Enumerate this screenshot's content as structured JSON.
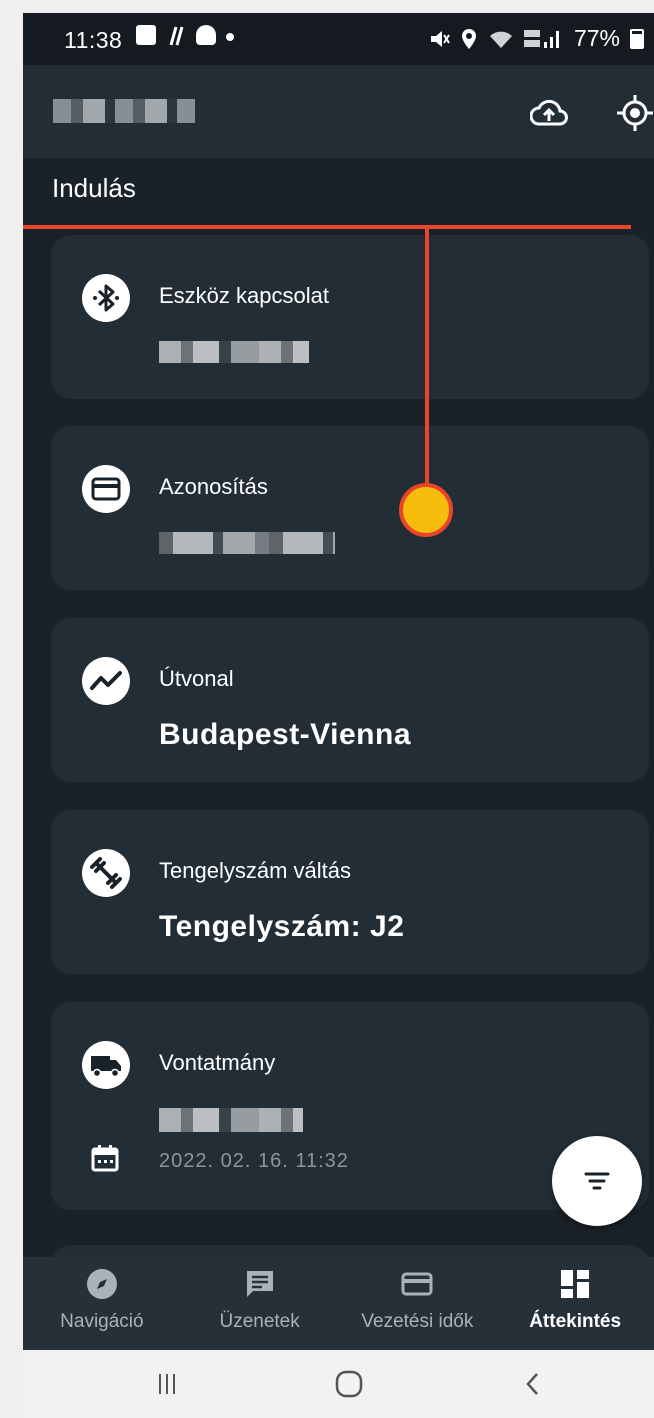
{
  "status_bar": {
    "time": "11:38",
    "battery": "77%"
  },
  "app_bar": {
    "icons": [
      "cloud-upload-icon",
      "gps-target-icon"
    ]
  },
  "section": {
    "title": "Indulás"
  },
  "cards": [
    {
      "icon": "bluetooth-icon",
      "title": "Eszköz kapcsolat"
    },
    {
      "icon": "card-icon",
      "title": "Azonosítás"
    },
    {
      "icon": "route-icon",
      "title": "Útvonal",
      "value": "Budapest-Vienna"
    },
    {
      "icon": "axle-icon",
      "title": "Tengelyszám váltás",
      "value": "Tengelyszám: J2"
    },
    {
      "icon": "truck-icon",
      "title": "Vontatmány",
      "date": "2022. 02. 16. 11:32"
    }
  ],
  "bottom_nav": {
    "items": [
      {
        "label": "Navigáció",
        "icon": "compass-icon"
      },
      {
        "label": "Üzenetek",
        "icon": "message-icon"
      },
      {
        "label": "Vezetési idők",
        "icon": "card-icon"
      },
      {
        "label": "Áttekintés",
        "icon": "dashboard-icon"
      }
    ],
    "active": "Áttekintés"
  },
  "colors": {
    "background": "#1a2229",
    "card": "#232d35",
    "annotation_line": "#e8452a",
    "annotation_dot": "#f7bd0d"
  }
}
